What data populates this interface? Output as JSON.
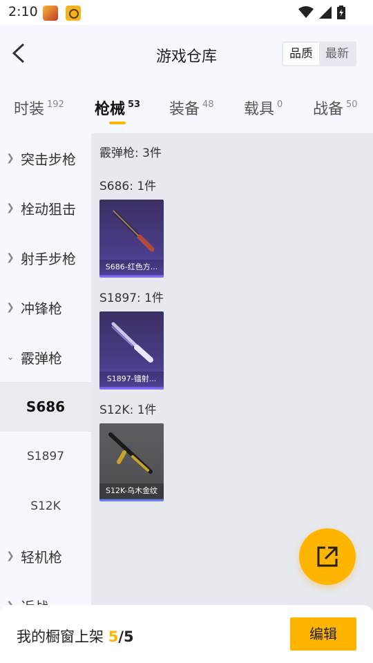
{
  "status_bar": {
    "time": "2:10"
  },
  "header": {
    "title": "游戏仓库",
    "sort_options": [
      "品质",
      "最新"
    ],
    "active_sort": "品质"
  },
  "tabs": [
    {
      "label": "时装",
      "count": "192"
    },
    {
      "label": "枪械",
      "count": "53"
    },
    {
      "label": "装备",
      "count": "48"
    },
    {
      "label": "载具",
      "count": "0"
    },
    {
      "label": "战备",
      "count": "50"
    }
  ],
  "active_tab": "枪械",
  "sidebar": {
    "categories": [
      "突击步枪",
      "栓动狙击",
      "射手步枪",
      "冲锋枪",
      "霰弹枪",
      "轻机枪",
      "近战"
    ],
    "expanded": "霰弹枪",
    "subitems": [
      "S686",
      "S1897",
      "S12K"
    ],
    "selected_sub": "S686"
  },
  "content": {
    "group_title": "霰弹枪: 3件",
    "sections": [
      {
        "title": "S686: 1件",
        "card_label": "S686-红色方...",
        "card_style": "purple"
      },
      {
        "title": "S1897: 1件",
        "card_label": "S1897-镭射...",
        "card_style": "purple"
      },
      {
        "title": "S12K: 1件",
        "card_label": "S12K-乌木金纹",
        "card_style": "gray"
      }
    ]
  },
  "bottom": {
    "label": "我的橱窗上架",
    "count": "5",
    "separator": "/",
    "total": "5",
    "edit_label": "编辑"
  },
  "icons": {
    "back": "chevron-left-icon",
    "fab": "share-external-icon",
    "wifi": "wifi-icon",
    "signal": "signal-icon",
    "battery": "battery-icon"
  },
  "colors": {
    "accent": "#ffb400",
    "card_purple": "#4b3d8a",
    "card_gray": "#55565a"
  }
}
